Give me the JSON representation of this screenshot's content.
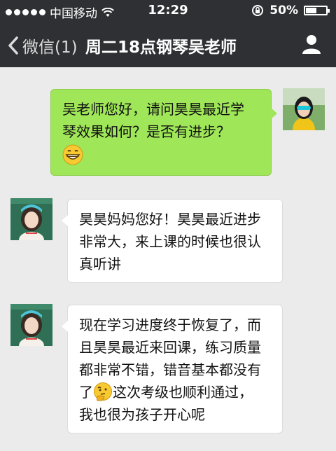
{
  "status_bar": {
    "carrier": "中国移动",
    "time": "12:29",
    "battery": "50%",
    "battery_level": 0.5
  },
  "nav": {
    "back_label": "微信(1)",
    "title": "周二18点钢琴吴老师"
  },
  "messages": [
    {
      "sender": "me",
      "text": "吴老师您好，请问昊昊最近学\n琴效果如何？是否有进步？",
      "emoji": "grinning-face-emoji"
    },
    {
      "sender": "teacher",
      "text": "昊昊妈妈您好！昊昊最近进步\n非常大，来上课的时候也很认\n真听讲"
    },
    {
      "sender": "teacher",
      "text_before_emoji": "现在学习进度终于恢复了，而\n且昊昊最近来回课，练习质量\n都非常不错，错音基本都没有\n了",
      "emoji": "thinking-face-emoji",
      "text_after_emoji": "这次考级也顺利通过，\n我也很为孩子开心呢"
    }
  ]
}
